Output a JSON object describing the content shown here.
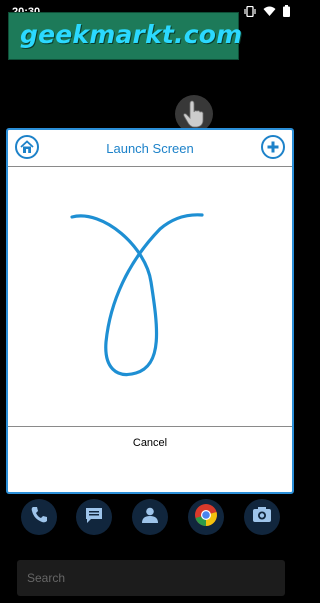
{
  "status_bar": {
    "time": "20:30",
    "icons": [
      "vibrate-icon",
      "wifi-icon",
      "battery-icon"
    ]
  },
  "watermark": {
    "text": "geekmarkt.com"
  },
  "floating_button": {
    "icon": "hand-pointer-icon"
  },
  "dialog": {
    "title": "Launch Screen",
    "home_icon": "home-icon",
    "add_icon": "plus-icon",
    "cancel_label": "Cancel",
    "stroke_color": "#1e8fd3"
  },
  "dock": {
    "apps": [
      {
        "name": "phone",
        "icon": "phone-icon"
      },
      {
        "name": "messages",
        "icon": "message-icon"
      },
      {
        "name": "contacts",
        "icon": "contacts-icon"
      },
      {
        "name": "chrome",
        "icon": "chrome-icon"
      },
      {
        "name": "camera",
        "icon": "camera-icon"
      }
    ]
  },
  "search": {
    "placeholder": "Search"
  },
  "colors": {
    "accent": "#1d82c9",
    "background": "#000000",
    "watermark_bg": "#1d7a59"
  }
}
